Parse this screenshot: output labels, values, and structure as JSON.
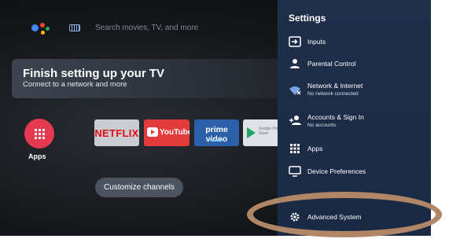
{
  "home": {
    "search_placeholder": "Search movies, TV, and more",
    "setup_card": {
      "title": "Finish setting up your TV",
      "subtitle": "Connect to a network and more"
    },
    "apps_label": "Apps",
    "tiles": {
      "netflix": "NETFLIX",
      "youtube": "YouTube",
      "prime": "prime video",
      "google_play": "Google Play Store"
    },
    "customize_label": "Customize channels"
  },
  "settings": {
    "title": "Settings",
    "items": [
      {
        "label": "Inputs",
        "icon": "input-icon"
      },
      {
        "label": "Parental Control",
        "icon": "person-icon"
      },
      {
        "label": "Network & Internet",
        "sub": "No network connected",
        "icon": "wifi-icon"
      },
      {
        "label": "Accounts & Sign In",
        "sub": "No accounts",
        "icon": "add-person-icon"
      },
      {
        "label": "Apps",
        "icon": "apps-grid-icon"
      },
      {
        "label": "Device Preferences",
        "icon": "tv-icon"
      },
      {
        "label": "Advanced System",
        "icon": "gear-icon"
      }
    ]
  },
  "colors": {
    "settings_bg": "#1f2f4a",
    "apps_red": "#e53950",
    "highlight_ring": "#b08666"
  }
}
